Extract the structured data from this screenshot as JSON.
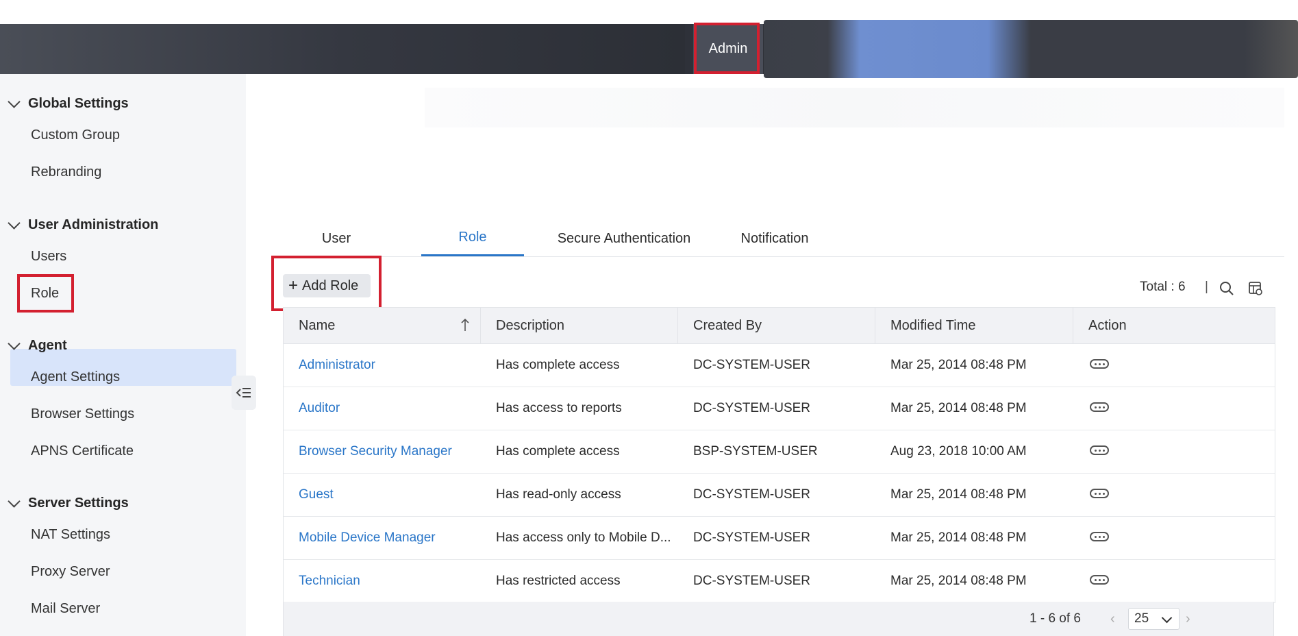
{
  "header": {
    "admin_tab": "Admin"
  },
  "sidebar": {
    "sections": [
      {
        "title": "Global Settings",
        "items": [
          "Custom Group",
          "Rebranding"
        ]
      },
      {
        "title": "User Administration",
        "items": [
          "Users",
          "Role"
        ]
      },
      {
        "title": "Agent",
        "items": [
          "Agent Settings",
          "Browser Settings",
          "APNS Certificate"
        ]
      },
      {
        "title": "Server Settings",
        "items": [
          "NAT Settings",
          "Proxy Server",
          "Mail Server"
        ]
      }
    ],
    "active_item": "Role"
  },
  "tabs": [
    "User",
    "Role",
    "Secure Authentication",
    "Notification"
  ],
  "active_tab": "Role",
  "toolbar": {
    "add_role_label": "Add Role",
    "total_label": "Total : 6",
    "separator": "|"
  },
  "table": {
    "headers": [
      "Name",
      "Description",
      "Created By",
      "Modified Time",
      "Action"
    ],
    "rows": [
      [
        "Administrator",
        "Has complete access",
        "DC-SYSTEM-USER",
        "Mar 25, 2014 08:48 PM"
      ],
      [
        "Auditor",
        "Has access to reports",
        "DC-SYSTEM-USER",
        "Mar 25, 2014 08:48 PM"
      ],
      [
        "Browser Security Manager",
        "Has complete access",
        "BSP-SYSTEM-USER",
        "Aug 23, 2018 10:00 AM"
      ],
      [
        "Guest",
        "Has read-only access",
        "DC-SYSTEM-USER",
        "Mar 25, 2014 08:48 PM"
      ],
      [
        "Mobile Device Manager",
        "Has access only to Mobile D...",
        "DC-SYSTEM-USER",
        "Mar 25, 2014 08:48 PM"
      ],
      [
        "Technician",
        "Has restricted access",
        "DC-SYSTEM-USER",
        "Mar 25, 2014 08:48 PM"
      ]
    ]
  },
  "pagination": {
    "range": "1 - 6 of 6",
    "per_page": "25",
    "prev": "‹",
    "next": "›"
  },
  "colors": {
    "accent": "#2a76c8",
    "highlight": "#d32030",
    "active_bg": "#d8e4fa",
    "header_bg": "#2f323a"
  }
}
